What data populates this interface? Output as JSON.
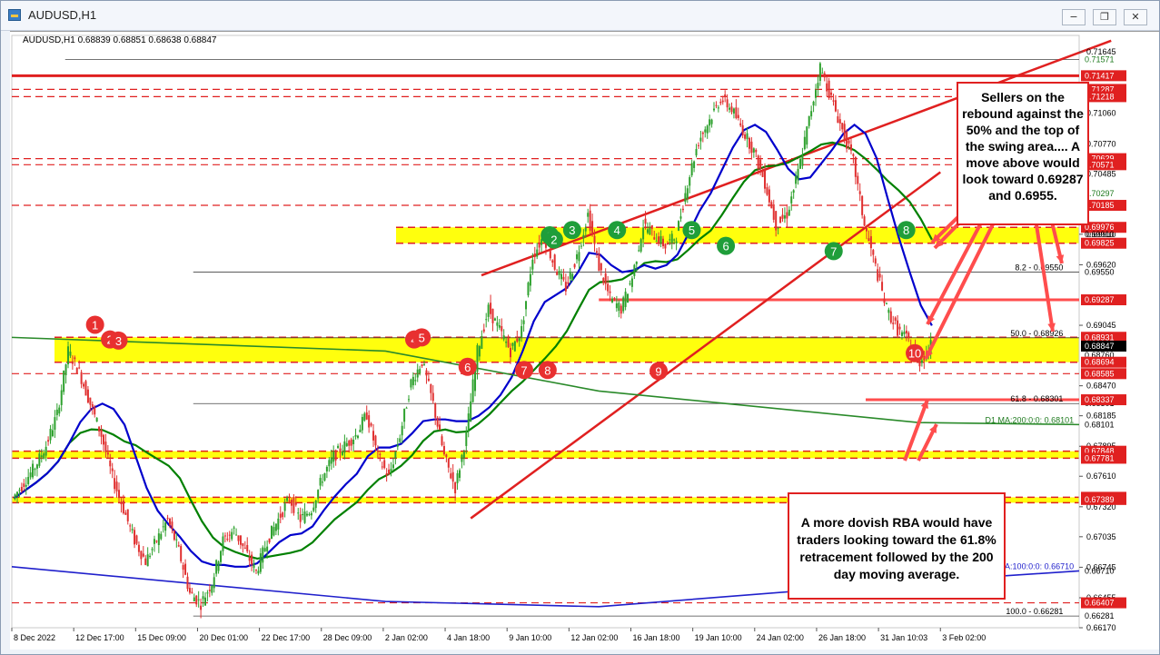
{
  "window": {
    "title": "AUDUSD,H1"
  },
  "header": {
    "info": "AUDUSD,H1  0.68839 0.68851 0.68638 0.68847"
  },
  "callouts": {
    "top": "Sellers on the rebound against the 50% and the top of the swing area.... A move above would look toward 0.69287 and 0.6955.",
    "bottom": "A more dovish RBA would have traders looking toward the 61.8% retracement followed by the 200 day moving average."
  },
  "colors": {
    "bull_candle": "#2ea12e",
    "bear_candle": "#e03030",
    "support_zone": "#ffff00",
    "resistance": "#ff0000",
    "ma_short": "#0000cc",
    "ma_long": "#008000"
  },
  "chart_data": {
    "type": "candlestick",
    "symbol": "AUDUSD",
    "timeframe": "H1",
    "ylim": [
      0.6617,
      0.718
    ],
    "ohlc_last": {
      "open": 0.68839,
      "high": 0.68851,
      "low": 0.68638,
      "close": 0.68847
    },
    "x_ticks": [
      "8 Dec 2022",
      "12 Dec 17:00",
      "15 Dec 09:00",
      "20 Dec 01:00",
      "22 Dec 17:00",
      "28 Dec 09:00",
      "2 Jan 02:00",
      "4 Jan 18:00",
      "9 Jan 10:00",
      "12 Jan 02:00",
      "16 Jan 18:00",
      "19 Jan 10:00",
      "24 Jan 02:00",
      "26 Jan 18:00",
      "31 Jan 10:03",
      "3 Feb 02:00"
    ],
    "y_ticks": [
      "0.71645",
      "0.71060",
      "0.70770",
      "0.70485",
      "0.69910",
      "0.69620",
      "0.69045",
      "0.68470",
      "0.68185",
      "0.67895",
      "0.67610",
      "0.67320",
      "0.67035",
      "0.66745",
      "0.66455",
      "0.66170"
    ],
    "price_labels": [
      {
        "text": "0.71571",
        "value": 0.71571,
        "bg": ""
      },
      {
        "text": "0.71417",
        "value": 0.71417,
        "bg": "#e02020"
      },
      {
        "text": "0.71287",
        "value": 0.71287,
        "bg": "#e02020"
      },
      {
        "text": "0.71218",
        "value": 0.71218,
        "bg": "#e02020"
      },
      {
        "text": "0.70629",
        "value": 0.70629,
        "bg": "#e02020"
      },
      {
        "text": "0.70575",
        "value": 0.70575,
        "bg": ""
      },
      {
        "text": "0.70571",
        "value": 0.70571,
        "bg": "#e02020"
      },
      {
        "text": "0.70297",
        "value": 0.70297,
        "bg": ""
      },
      {
        "text": "0.70185",
        "value": 0.70185,
        "bg": "#e02020"
      },
      {
        "text": "0.69976",
        "value": 0.69976,
        "bg": "#e02020"
      },
      {
        "text": "0.69910",
        "value": 0.6991,
        "bg": ""
      },
      {
        "text": "0.69825",
        "value": 0.69825,
        "bg": "#e02020"
      },
      {
        "text": "0.69550",
        "value": 0.6955,
        "bg": ""
      },
      {
        "text": "0.69287",
        "value": 0.69287,
        "bg": "#e02020"
      },
      {
        "text": "0.68926",
        "value": 0.68926,
        "bg": ""
      },
      {
        "text": "0.68931",
        "value": 0.68931,
        "bg": "#e02020"
      },
      {
        "text": "0.68847",
        "value": 0.68847,
        "bg": "#000000"
      },
      {
        "text": "0.68760",
        "value": 0.6876,
        "bg": ""
      },
      {
        "text": "0.68694",
        "value": 0.68694,
        "bg": "#e02020"
      },
      {
        "text": "0.68585",
        "value": 0.68585,
        "bg": "#e02020"
      },
      {
        "text": "0.68301",
        "value": 0.68301,
        "bg": ""
      },
      {
        "text": "0.68337",
        "value": 0.68337,
        "bg": "#e02020"
      },
      {
        "text": "0.68101",
        "value": 0.68101,
        "bg": ""
      },
      {
        "text": "0.67848",
        "value": 0.67848,
        "bg": "#e02020"
      },
      {
        "text": "0.67781",
        "value": 0.67781,
        "bg": "#e02020"
      },
      {
        "text": "0.67410",
        "value": 0.6741,
        "bg": "#e02020"
      },
      {
        "text": "0.67389",
        "value": 0.67389,
        "bg": "#e02020"
      },
      {
        "text": "0.66710",
        "value": 0.6671,
        "bg": ""
      },
      {
        "text": "0.66407",
        "value": 0.66407,
        "bg": "#e02020"
      },
      {
        "text": "0.66281",
        "value": 0.66281,
        "bg": ""
      }
    ],
    "fib_levels": [
      {
        "label": "8.2 - 0.69550",
        "value": 0.6955
      },
      {
        "label": "50.0 - 0.68926",
        "value": 0.68926
      },
      {
        "label": "61.8 - 0.68301",
        "value": 0.68301
      },
      {
        "label": "100.0 - 0.66281",
        "value": 0.66281
      }
    ],
    "ma_labels": [
      {
        "label": "D1 MA:200:0:0: 0.68101",
        "value": 0.68101
      },
      {
        "label": "D1 MA:100:0:0: 0.66710",
        "value": 0.6671
      }
    ],
    "zones": [
      {
        "from": 0.69825,
        "to": 0.69976
      },
      {
        "from": 0.68694,
        "to": 0.68931
      },
      {
        "from": 0.67781,
        "to": 0.67848
      },
      {
        "from": 0.67389,
        "to": 0.6741
      }
    ],
    "resistance_lines": [
      0.71417,
      0.69287,
      0.68337
    ],
    "swing_markers": [
      {
        "label": "1",
        "color": "red"
      },
      {
        "label": "2",
        "color": "red"
      },
      {
        "label": "3",
        "color": "red"
      },
      {
        "label": "4",
        "color": "red"
      },
      {
        "label": "5",
        "color": "red"
      },
      {
        "label": "6",
        "color": "red"
      },
      {
        "label": "7",
        "color": "red"
      },
      {
        "label": "8",
        "color": "red"
      },
      {
        "label": "9",
        "color": "red"
      },
      {
        "label": "10",
        "color": "red"
      },
      {
        "label": "1",
        "color": "green"
      },
      {
        "label": "2",
        "color": "green"
      },
      {
        "label": "3",
        "color": "green"
      },
      {
        "label": "4",
        "color": "green"
      },
      {
        "label": "5",
        "color": "green"
      },
      {
        "label": "6",
        "color": "green"
      },
      {
        "label": "7",
        "color": "green"
      },
      {
        "label": "8",
        "color": "green"
      }
    ],
    "price_path": [
      0.674,
      0.6755,
      0.677,
      0.679,
      0.682,
      0.688,
      0.686,
      0.683,
      0.68,
      0.676,
      0.673,
      0.67,
      0.668,
      0.67,
      0.672,
      0.669,
      0.665,
      0.664,
      0.666,
      0.67,
      0.671,
      0.669,
      0.667,
      0.67,
      0.672,
      0.674,
      0.672,
      0.673,
      0.676,
      0.678,
      0.679,
      0.68,
      0.682,
      0.678,
      0.676,
      0.68,
      0.685,
      0.687,
      0.683,
      0.678,
      0.675,
      0.68,
      0.688,
      0.692,
      0.69,
      0.688,
      0.69,
      0.697,
      0.699,
      0.696,
      0.694,
      0.697,
      0.701,
      0.696,
      0.693,
      0.692,
      0.695,
      0.7,
      0.699,
      0.698,
      0.699,
      0.704,
      0.708,
      0.71,
      0.712,
      0.711,
      0.709,
      0.707,
      0.704,
      0.7,
      0.701,
      0.705,
      0.71,
      0.715,
      0.712,
      0.709,
      0.706,
      0.7,
      0.696,
      0.692,
      0.69,
      0.689,
      0.687,
      0.6885
    ]
  }
}
